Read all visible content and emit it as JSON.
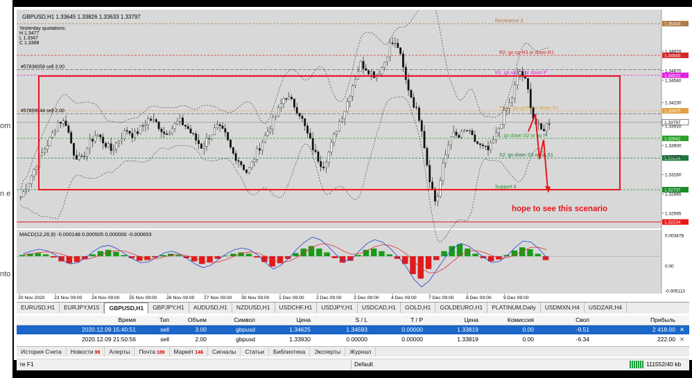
{
  "chart_data": {
    "type": "candlestick",
    "symbol_header": "GBPUSD,H1  1.33645 1.33826 1.33633 1.33797",
    "yesterday": {
      "title": "Yesterday quotations:",
      "h": "H 1.3477",
      "l": "L 1.3347",
      "c": "C 1.3388"
    },
    "ylim": [
      1.3215,
      1.3554
    ],
    "y_ticks": [
      "1.34970",
      "1.34670",
      "1.34540",
      "1.34230",
      "1.33910",
      "1.33600",
      "1.33450",
      "1.33160",
      "1.32865",
      "1.32565"
    ],
    "x_ticks": [
      "20 Nov 2020",
      "23 Nov 09:00",
      "24 Nov 09:00",
      "25 Nov 09:00",
      "26 Nov 09:00",
      "27 Nov 09:00",
      "30 Nov 09:00",
      "1 Dec 09:00",
      "2 Dec 09:00",
      "3 Dec 09:00",
      "4 Dec 09:00",
      "7 Dec 09:00",
      "8 Dec 09:00",
      "9 Dec 09:00"
    ],
    "close_path": [
      1.3262,
      1.3285,
      1.3312,
      1.3335,
      1.3355,
      1.3382,
      1.3378,
      1.3332,
      1.3318,
      1.3345,
      1.3362,
      1.3348,
      1.3335,
      1.3352,
      1.3368,
      1.3358,
      1.3372,
      1.3385,
      1.3378,
      1.3362,
      1.337,
      1.3382,
      1.3372,
      1.3355,
      1.334,
      1.3358,
      1.3372,
      1.3362,
      1.3332,
      1.3318,
      1.33,
      1.3325,
      1.335,
      1.3372,
      1.3395,
      1.3422,
      1.341,
      1.3392,
      1.336,
      1.333,
      1.331,
      1.3338,
      1.3375,
      1.3402,
      1.344,
      1.3472,
      1.3462,
      1.3452,
      1.3468,
      1.3505,
      1.3498,
      1.3445,
      1.341,
      1.338,
      1.33,
      1.325,
      1.3315,
      1.3362,
      1.3355,
      1.3368,
      1.3352,
      1.334,
      1.3335,
      1.336,
      1.3392,
      1.3415,
      1.3462,
      1.344,
      1.338,
      1.3366,
      1.338
    ],
    "levels": [
      {
        "label": "Resistance 3",
        "value": 1.35343,
        "price": "1.35343",
        "color": "#b07a4a"
      },
      {
        "label": "R2: go up R3 or down R1",
        "value": 1.34845,
        "price": "1.34845",
        "color": "#d42a2a"
      },
      {
        "label": "R1: go up R2 or down P",
        "value": 1.34532,
        "price": "1.34532",
        "color": "#e022e0"
      },
      {
        "label": "Pivot: go up R1 or down S1",
        "value": 1.33975,
        "price": "1.33975",
        "color": "#e0a040"
      },
      {
        "label": "S1: go down S2 or up P",
        "value": 1.33542,
        "price": "1.33542",
        "color": "#2aa02a"
      },
      {
        "label": "S2: go down S3 or up S1",
        "value": 1.33234,
        "price": "1.33234",
        "color": "#1a7a3a"
      },
      {
        "label": "Support 3",
        "value": 1.32737,
        "price": "1.32737",
        "color": "#1a8a2a"
      }
    ],
    "order_lines": [
      {
        "label": "#57836058 sell 3.00",
        "value": 1.3462
      },
      {
        "label": "#57859944 sell 2.00",
        "value": 1.3393
      }
    ],
    "current_price": {
      "value": 1.33797,
      "price": "1.33797"
    },
    "bottom_line": {
      "value": 1.3223,
      "price": "1.32234"
    },
    "annotation": "hope to see this scenario",
    "macd": {
      "header": "MACD(12,26,9) -0.000148 0.000505 0.000000 -0.000653",
      "ticks": [
        "0.003478",
        "0.00",
        "-0.005113"
      ],
      "ylim": [
        -0.0054,
        0.0037
      ],
      "hist": [
        0.0002,
        0.0004,
        0.0005,
        0.0003,
        -0.0002,
        -0.0008,
        -0.0011,
        -0.0009,
        -0.0004,
        0.0003,
        0.0008,
        0.001,
        0.0007,
        0.0002,
        -0.0003,
        -0.0007,
        -0.0006,
        -0.0002,
        0.0002,
        0.0004,
        0.0002,
        -0.0003,
        -0.0008,
        -0.0012,
        -0.0009,
        -0.0004,
        0.0001,
        0.0004,
        0.0006,
        0.0004,
        -0.0002,
        -0.0009,
        -0.0016,
        -0.0011,
        -0.0004,
        0.0005,
        0.0012,
        0.0016,
        0.0012,
        0.0006,
        -0.0003,
        -0.001,
        -0.0007,
        0.0002,
        0.001,
        0.0012,
        0.0008,
        0.0003,
        -0.0004,
        -0.0012,
        -0.0028,
        -0.0035,
        -0.002,
        -0.0006,
        0.0008,
        0.0016,
        0.0019,
        0.0012,
        0.0004,
        -0.0003,
        -0.0008,
        -0.0005,
        0.0002,
        0.0009,
        0.0014,
        0.0011,
        0.0004,
        -0.0006
      ],
      "macd_line": [
        0.0004,
        0.0008,
        0.0011,
        0.0009,
        0.0003,
        -0.0006,
        -0.0012,
        -0.001,
        -0.0002,
        0.0008,
        0.0015,
        0.0017,
        0.0012,
        0.0004,
        -0.0004,
        -0.001,
        -0.0009,
        -0.0002,
        0.0005,
        0.0008,
        0.0004,
        -0.0004,
        -0.0012,
        -0.0018,
        -0.0014,
        -0.0005,
        0.0004,
        0.001,
        0.0013,
        0.001,
        0.0002,
        -0.001,
        -0.002,
        -0.0014,
        -0.0003,
        0.0011,
        0.0022,
        0.003,
        0.0026,
        0.0016,
        0.0003,
        -0.0008,
        -0.0005,
        0.0008,
        0.002,
        0.0026,
        0.0022,
        0.0012,
        -0.0001,
        -0.0016,
        -0.0036,
        -0.0048,
        -0.0038,
        -0.002,
        -0.0002,
        0.0012,
        0.002,
        0.0016,
        0.0007,
        -0.0002,
        -0.001,
        -0.0008,
        0.0002,
        0.0014,
        0.0024,
        0.0022,
        0.0012,
        -0.0002
      ],
      "signal_line": [
        0.0002,
        0.0004,
        0.0006,
        0.0007,
        0.0006,
        0.0003,
        -0.0001,
        -0.0004,
        -0.0005,
        -0.0002,
        0.0003,
        0.0007,
        0.0009,
        0.0008,
        0.0004,
        -0.0001,
        -0.0004,
        -0.0004,
        -0.0001,
        0.0002,
        0.0003,
        0.0001,
        -0.0003,
        -0.0008,
        -0.001,
        -0.0009,
        -0.0005,
        0.0,
        0.0005,
        0.0007,
        0.0005,
        0.0,
        -0.0006,
        -0.0009,
        -0.0008,
        -0.0002,
        0.0006,
        0.0014,
        0.0019,
        0.0019,
        0.0015,
        0.0008,
        0.0003,
        0.0004,
        0.0009,
        0.0015,
        0.0018,
        0.0017,
        0.0012,
        0.0004,
        -0.0008,
        -0.002,
        -0.0026,
        -0.0025,
        -0.0018,
        -0.0008,
        0.0002,
        0.0008,
        0.0009,
        0.0006,
        0.0001,
        -0.0003,
        -0.0002,
        0.0002,
        0.0009,
        0.0014,
        0.0014,
        0.001
      ]
    }
  },
  "symbol_tabs": [
    "EURUSD,H1",
    "EURJPY,M15",
    "GBPUSD,H1",
    "GBPJPY,H1",
    "AUDUSD,H1",
    "NZDUSD,H1",
    "USDCHF,H1",
    "USDJPY,H1",
    "USDCAD,H1",
    "GOLD,H1",
    "GOLDEURO,H1",
    "PLATINUM,Daily",
    "USDMXN,H4",
    "USDZAR,H4"
  ],
  "trades": {
    "headers": [
      "Время",
      "Тип",
      "Объем",
      "Символ",
      "Цена",
      "S / L",
      "T / P",
      "Цена",
      "Комиссия",
      "Своп",
      "Прибыль"
    ],
    "rows": [
      [
        "2020.12.09 15:40:51",
        "sell",
        "3.00",
        "gbpusd",
        "1.34625",
        "1.34593",
        "0.00000",
        "1.33819",
        "0.00",
        "-9.51",
        "2 418.00"
      ],
      [
        "2020.12.09 21:50:56",
        "sell",
        "2.00",
        "gbpusd",
        "1.33930",
        "0.00000",
        "0.00000",
        "1.33819",
        "0.00",
        "-6.34",
        "222.00"
      ]
    ],
    "close_glyph": "✕"
  },
  "bottom_tabs": [
    {
      "label": "История Счета",
      "count": ""
    },
    {
      "label": "Новости",
      "count": "99"
    },
    {
      "label": "Алерты",
      "count": ""
    },
    {
      "label": "Почта",
      "count": "189"
    },
    {
      "label": "Маркет",
      "count": "146"
    },
    {
      "label": "Сигналы",
      "count": ""
    },
    {
      "label": "Статьи",
      "count": ""
    },
    {
      "label": "Библиотека",
      "count": ""
    },
    {
      "label": "Эксперты",
      "count": ""
    },
    {
      "label": "Журнал",
      "count": ""
    }
  ],
  "status": {
    "help": "те F1",
    "profile": "Default",
    "traffic": "111552/40 kb"
  },
  "left_fragments": [
    "om",
    "n e",
    "nto"
  ],
  "colors": {
    "bull": "#2a2a2a",
    "bear": "#1a1a1a",
    "highlight_box": "#e8141c",
    "macd_hist_pos": "#1a9a1a",
    "macd_hist_neg": "#e01a1a",
    "macd_line": "#2040d0",
    "signal_line": "#e03030"
  }
}
